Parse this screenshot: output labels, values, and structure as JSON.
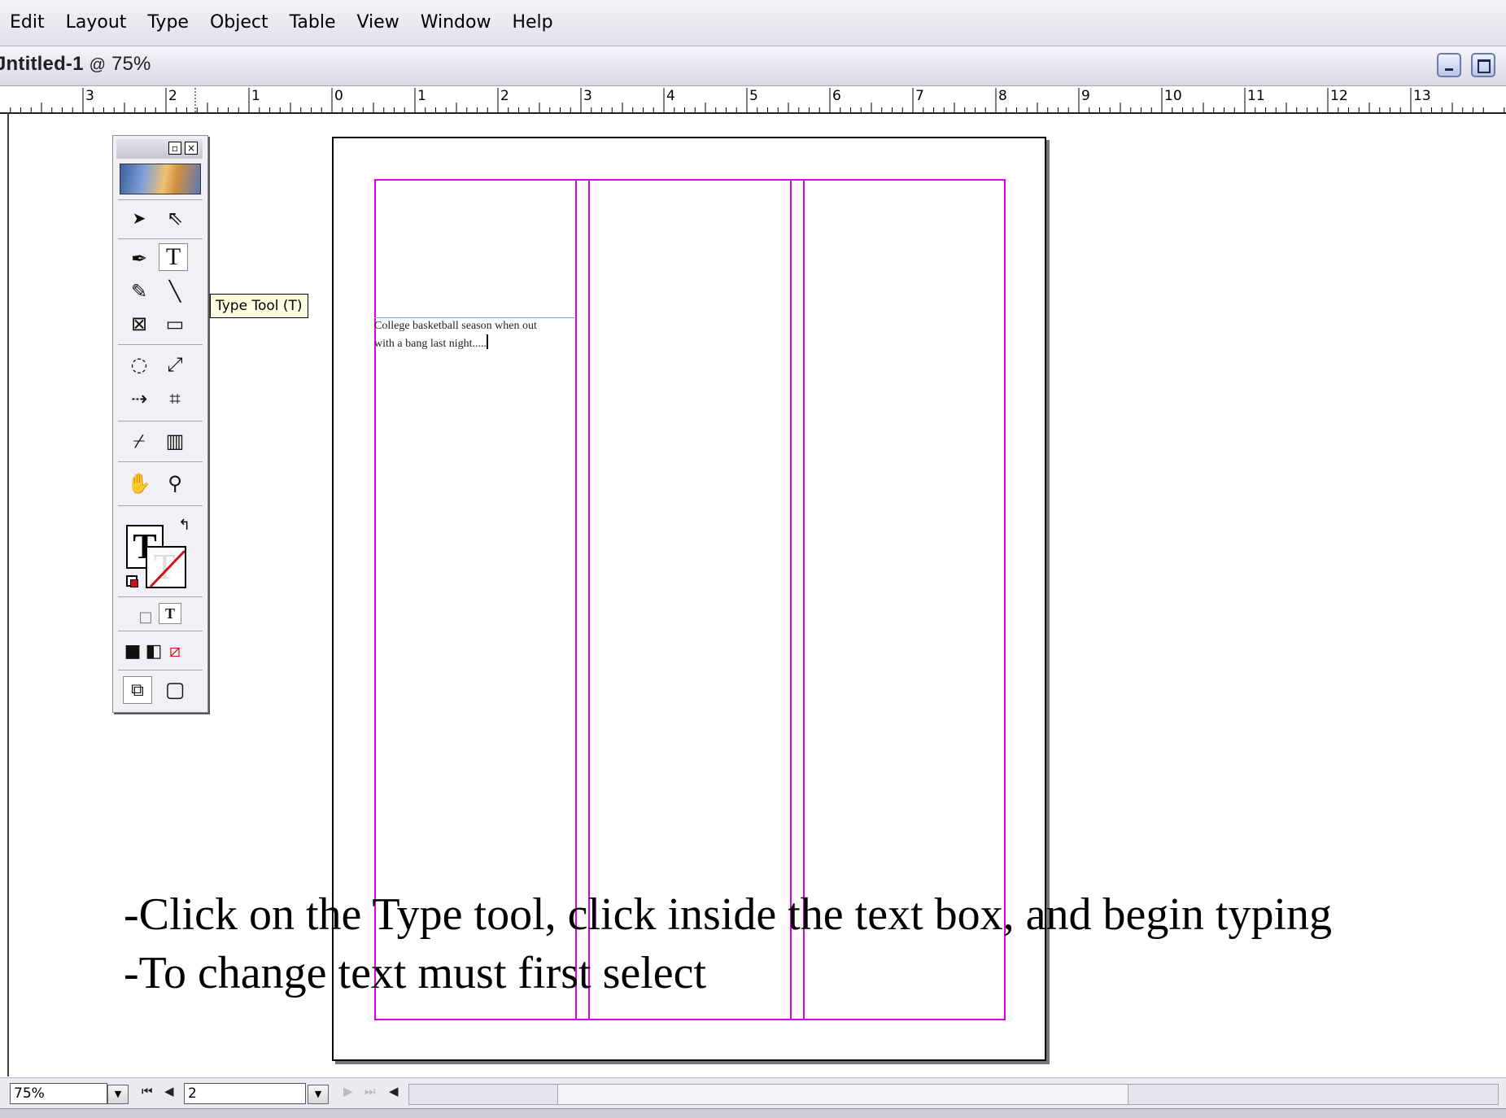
{
  "menubar": {
    "items": [
      "Edit",
      "Layout",
      "Type",
      "Object",
      "Table",
      "View",
      "Window",
      "Help"
    ]
  },
  "document": {
    "title": "Jntitled-1",
    "zoom_separator": "@",
    "zoom": "75%"
  },
  "ruler": {
    "labels": [
      "3",
      "2",
      "1",
      "0",
      "1",
      "2",
      "3",
      "4",
      "5",
      "6",
      "7",
      "8",
      "9",
      "10",
      "11",
      "12",
      "13"
    ]
  },
  "page": {
    "text_frame_lines": [
      "College basketball season when out",
      "with a bang last night....."
    ]
  },
  "toolbox": {
    "controls": {
      "minimize": "▫",
      "close": "×"
    },
    "tools": [
      {
        "name": "selection-tool",
        "glyph": "➤"
      },
      {
        "name": "direct-selection-tool",
        "glyph": "⇖"
      },
      {
        "name": "pen-tool",
        "glyph": "✒"
      },
      {
        "name": "type-tool",
        "glyph": "T"
      },
      {
        "name": "pencil-tool",
        "glyph": "✎"
      },
      {
        "name": "line-tool",
        "glyph": "╲"
      },
      {
        "name": "rectangle-frame-tool",
        "glyph": "⊠"
      },
      {
        "name": "rectangle-tool",
        "glyph": "▭"
      },
      {
        "name": "rotate-tool",
        "glyph": "◌"
      },
      {
        "name": "scale-tool",
        "glyph": "⤢"
      },
      {
        "name": "shear-tool",
        "glyph": "⇢"
      },
      {
        "name": "free-transform-tool",
        "glyph": "⌗"
      },
      {
        "name": "eyedropper-tool",
        "glyph": "⌿"
      },
      {
        "name": "gradient-tool",
        "glyph": "▥"
      },
      {
        "name": "hand-tool",
        "glyph": "✋"
      },
      {
        "name": "zoom-tool",
        "glyph": "⚲"
      }
    ],
    "fill_stroke": {
      "fill_glyph": "T",
      "stroke_glyph": "T",
      "swap_glyph": "↰"
    },
    "format_toggle": {
      "container": "□",
      "text": "T"
    },
    "apply_buttons": {
      "color": "■",
      "gradient": "◧",
      "none": "⧄"
    },
    "view_modes": {
      "normal": "⧉",
      "preview": "▢"
    }
  },
  "tooltip": {
    "text": "Type Tool (T)"
  },
  "instructions": {
    "line1": "-Click on the Type tool, click inside the text box, and begin typing",
    "line2": "-To change text must first select"
  },
  "statusbar": {
    "zoom_value": "75%",
    "page_value": "2",
    "nav": {
      "first": "⏮",
      "prev": "◀",
      "next": "▶",
      "last": "⏭",
      "scroll_left": "◀"
    }
  },
  "colors": {
    "guide": "#e000e0",
    "text_frame_edge": "#6fa7e6",
    "tooltip_bg": "#ffffe1"
  }
}
